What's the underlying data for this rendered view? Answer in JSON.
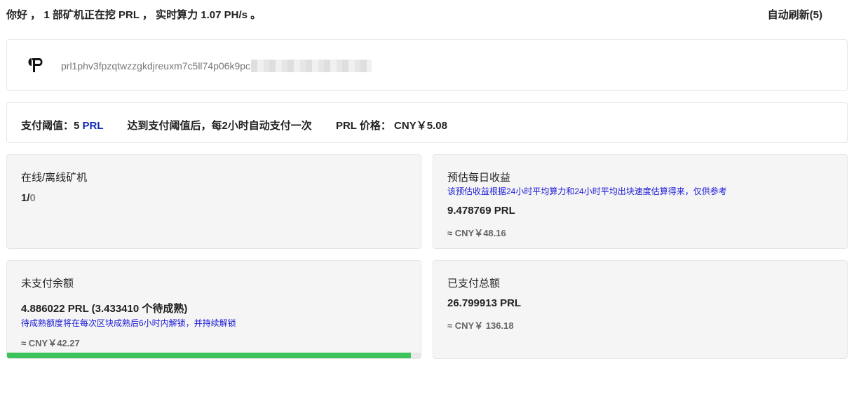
{
  "header": {
    "greeting": "你好 ， 1 部矿机正在挖 PRL ， 实时算力 1.07 PH/s 。",
    "refresh": "自动刷新(5)"
  },
  "wallet": {
    "logo_icon": "prl-logo-icon",
    "address": "prl1phv3fpzqtwzzgkdjreuxm7c5ll74p06k9pc"
  },
  "payment": {
    "threshold_label": "支付阈值：",
    "threshold_value": "5",
    "threshold_unit": "PRL",
    "schedule": "达到支付阈值后，每2小时自动支付一次",
    "price_label": "PRL 价格：",
    "price_value": "CNY￥5.08"
  },
  "miners": {
    "title": "在线/离线矿机",
    "online": "1",
    "separator": "/",
    "offline": "0"
  },
  "daily": {
    "title": "预估每日收益",
    "note": "该预估收益根据24小时平均算力和24小时平均出块速度估算得来，仅供参考",
    "value": "9.478769 PRL",
    "cny": "≈ CNY￥48.16"
  },
  "unpaid": {
    "title": "未支付余额",
    "value": "4.886022 PRL (3.433410 个待成熟)",
    "note": "待成熟额度将在每次区块成熟后6小时内解锁，并持续解锁",
    "cny": "≈ CNY￥42.27",
    "progress_fraction": 0.977,
    "progress_color": "#3cc35a"
  },
  "paid": {
    "title": "已支付总额",
    "value": "26.799913 PRL",
    "cny": "≈ CNY￥ 136.18"
  },
  "colors": {
    "accent_blue": "#1428b4",
    "note_blue": "#1a1ad6",
    "card_bg": "#f5f5f5"
  }
}
